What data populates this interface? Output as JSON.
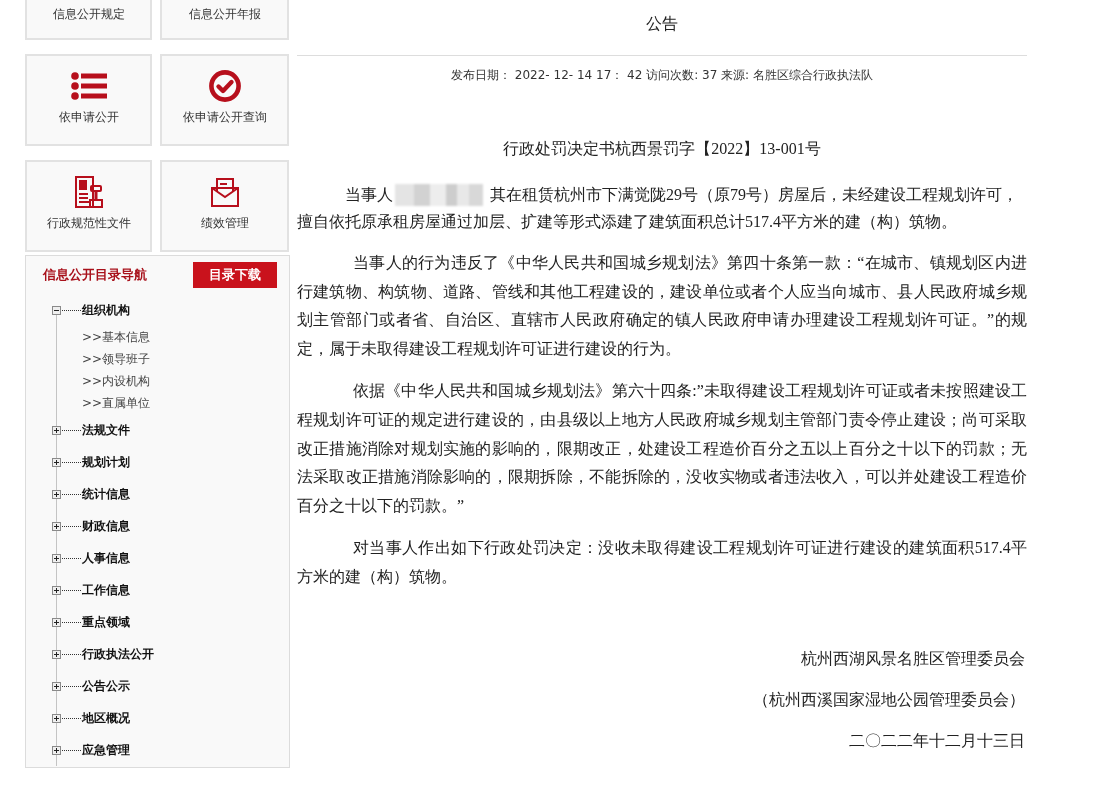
{
  "sidebar": {
    "tiles": [
      {
        "label": "信息公开规定"
      },
      {
        "label": "信息公开年报"
      },
      {
        "label": "依申请公开"
      },
      {
        "label": "依申请公开查询"
      },
      {
        "label": "行政规范性文件"
      },
      {
        "label": "绩效管理"
      }
    ],
    "catalog": {
      "title": "信息公开目录导航",
      "download_button": "目录下载",
      "items": [
        {
          "label": "组织机构",
          "expanded": true,
          "children": [
            {
              "label": ">>基本信息"
            },
            {
              "label": ">>领导班子"
            },
            {
              "label": ">>内设机构"
            },
            {
              "label": ">>直属单位"
            }
          ]
        },
        {
          "label": "法规文件",
          "expanded": false
        },
        {
          "label": "规划计划",
          "expanded": false
        },
        {
          "label": "统计信息",
          "expanded": false
        },
        {
          "label": "财政信息",
          "expanded": false
        },
        {
          "label": "人事信息",
          "expanded": false
        },
        {
          "label": "工作信息",
          "expanded": false
        },
        {
          "label": "重点领域",
          "expanded": false
        },
        {
          "label": "行政执法公开",
          "expanded": false
        },
        {
          "label": "公告公示",
          "expanded": false
        },
        {
          "label": "地区概况",
          "expanded": false
        },
        {
          "label": "应急管理",
          "expanded": false
        }
      ]
    }
  },
  "article": {
    "title": "公告",
    "meta": "发布日期： 2022- 12- 14 17： 42 访问次数: 37 来源: 名胜区综合行政执法队",
    "doc_title": "行政处罚决定书杭西景罚字【2022】13-001号",
    "paragraphs": [
      {
        "segments": [
          {
            "kind": "text",
            "text": "当事人"
          },
          {
            "kind": "redaction"
          },
          {
            "kind": "text",
            "text": "其在租赁杭州市下满觉陇29号（原79号）房屋后，未经建设工程规划许可，"
          },
          {
            "kind": "text",
            "text": "擅自依托原承租房屋通过加层、扩建等形式添建了建筑面积总计517.4平方米的建（构）筑物。"
          }
        ]
      },
      {
        "segments": [
          {
            "kind": "text",
            "text": "当事人的行为违反了《中华人民共和国城乡规划法》第四十条第一款：“在城市、镇规划区内进行建筑物、构筑物、道路、管线和其他工程建设的，建设单位或者个人应当向城市、县人民政府城乡规划主管部门或者省、自治区、直辖市人民政府确定的镇人民政府申请办理建设工程规划许可证。”的规定，属于未取得建设工程规划许可证进行建设的行为。"
          }
        ]
      },
      {
        "segments": [
          {
            "kind": "text",
            "text": "依据《中华人民共和国城乡规划法》第六十四条:”未取得建设工程规划许可证或者未按照建设工程规划许可证的规定进行建设的，由县级以上地方人民政府城乡规划主管部门责令停止建设；尚可采取改正措施消除对规划实施的影响的，限期改正，处建设工程造价百分之五以上百分之十以下的罚款；无法采取改正措施消除影响的，限期拆除，不能拆除的，没收实物或者违法收入，可以并处建设工程造价百分之十以下的罚款。”"
          }
        ]
      },
      {
        "segments": [
          {
            "kind": "text",
            "text": "对当事人作出如下行政处罚决定：没收未取得建设工程规划许可证进行建设的建筑面积517.4平方米的建（构）筑物。"
          }
        ]
      }
    ],
    "signature": [
      "杭州西湖风景名胜区管理委员会",
      "（杭州西溪国家湿地公园管理委员会）",
      "二〇二二年十二月十三日"
    ]
  }
}
